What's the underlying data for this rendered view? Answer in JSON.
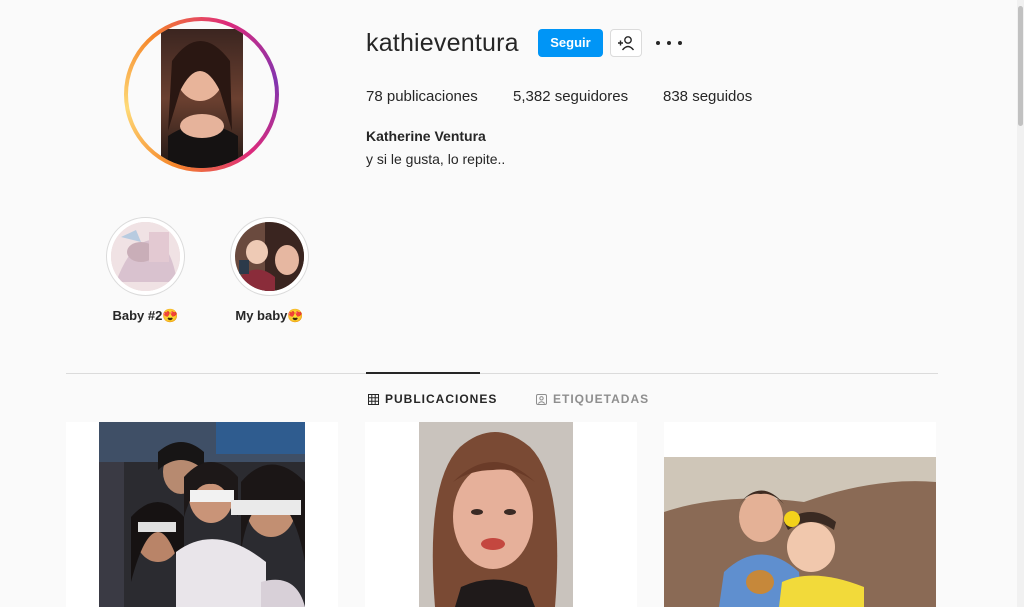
{
  "profile": {
    "username": "kathieventura",
    "follow_label": "Seguir",
    "posts": "78 publicaciones",
    "followers": "5,382 seguidores",
    "following": "838 seguidos",
    "full_name": "Katherine Ventura",
    "bio": "y si le gusta, lo repite.."
  },
  "highlights": [
    {
      "label": "Baby #2😍"
    },
    {
      "label": "My baby😍"
    }
  ],
  "tabs": [
    {
      "label": "PUBLICACIONES",
      "active": true
    },
    {
      "label": "ETIQUETADAS",
      "active": false
    }
  ],
  "colors": {
    "accent": "#0095f6",
    "text": "#262626",
    "muted": "#8e8e8e"
  }
}
